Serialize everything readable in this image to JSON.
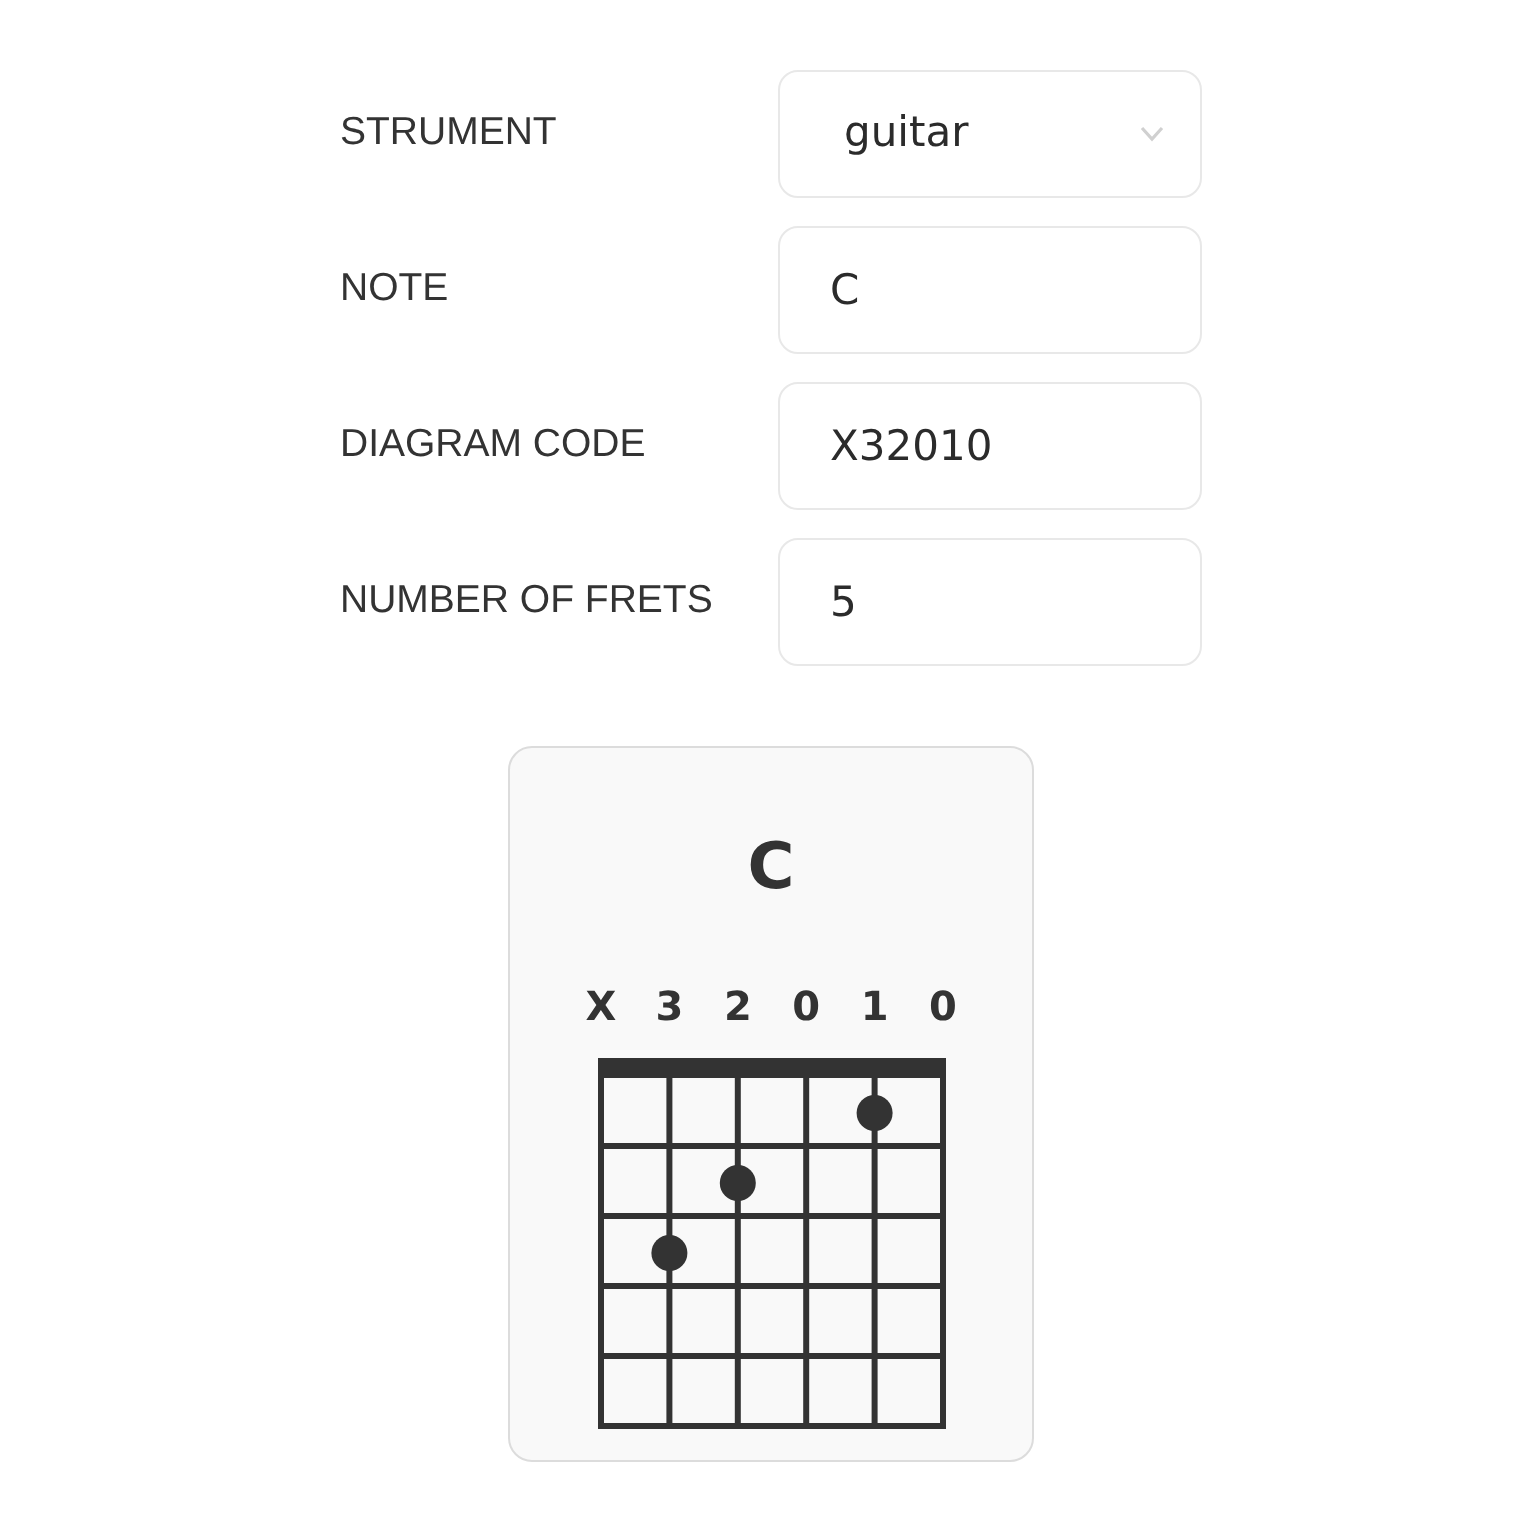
{
  "form": {
    "fields": [
      {
        "label": "STRUMENT",
        "kind": "select",
        "value": "guitar"
      },
      {
        "label": "NOTE",
        "kind": "text",
        "value": "C"
      },
      {
        "label": "DIAGRAM CODE",
        "kind": "text",
        "value": "X32010"
      },
      {
        "label": "NUMBER OF FRETS",
        "kind": "text",
        "value": "5"
      }
    ]
  },
  "chord_card": {
    "title": "C",
    "string_labels": [
      "X",
      "3",
      "2",
      "0",
      "1",
      "0"
    ],
    "frets": [
      {
        "pressed": [
          false,
          false,
          false,
          false,
          true,
          false
        ]
      },
      {
        "pressed": [
          false,
          false,
          true,
          false,
          false,
          false
        ]
      },
      {
        "pressed": [
          false,
          true,
          false,
          false,
          false,
          false
        ]
      },
      {
        "pressed": [
          false,
          false,
          false,
          false,
          false,
          false
        ]
      },
      {
        "pressed": [
          false,
          false,
          false,
          false,
          false,
          false
        ]
      }
    ]
  }
}
